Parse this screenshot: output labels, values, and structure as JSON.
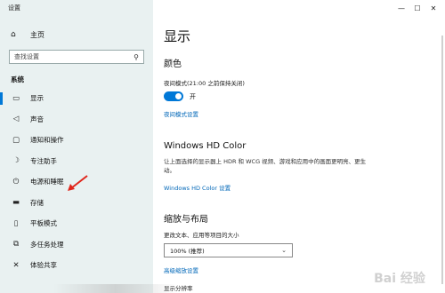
{
  "window": {
    "title": "设置",
    "controls": [
      "—",
      "☐",
      "✕"
    ]
  },
  "sidebar": {
    "home_label": "主页",
    "search_placeholder": "查找设置",
    "section_label": "系统",
    "items": [
      {
        "icon": "monitor-icon",
        "glyph": "▭",
        "label": "显示"
      },
      {
        "icon": "speaker-icon",
        "glyph": "◁",
        "label": "声音"
      },
      {
        "icon": "notification-icon",
        "glyph": "▢",
        "label": "通知和操作"
      },
      {
        "icon": "moon-icon",
        "glyph": "☽",
        "label": "专注助手"
      },
      {
        "icon": "power-icon",
        "glyph": "⏻",
        "label": "电源和睡眠"
      },
      {
        "icon": "storage-icon",
        "glyph": "▬",
        "label": "存储"
      },
      {
        "icon": "tablet-icon",
        "glyph": "▯",
        "label": "平板模式"
      },
      {
        "icon": "multitask-icon",
        "glyph": "⧉",
        "label": "多任务处理"
      },
      {
        "icon": "share-icon",
        "glyph": "✕",
        "label": "体验共享"
      }
    ]
  },
  "main": {
    "page_title": "显示",
    "color_heading": "颜色",
    "night_light_label": "夜间模式(21:00 之前保持关闭)",
    "night_light_state": "开",
    "night_light_settings_link": "夜间模式设置",
    "hd_color_heading": "Windows HD Color",
    "hd_color_desc": "让上面选择的显示器上 HDR 和 WCG 视频、游戏和应用中的画面更明亮、更生动。",
    "hd_color_link": "Windows HD Color 设置",
    "scale_heading": "缩放与布局",
    "scale_label": "更改文本、应用等项目的大小",
    "scale_value": "100% (推荐)",
    "advanced_scale_link": "高级缩放设置",
    "resolution_label": "显示分辨率"
  },
  "watermark": "Bai 经验"
}
